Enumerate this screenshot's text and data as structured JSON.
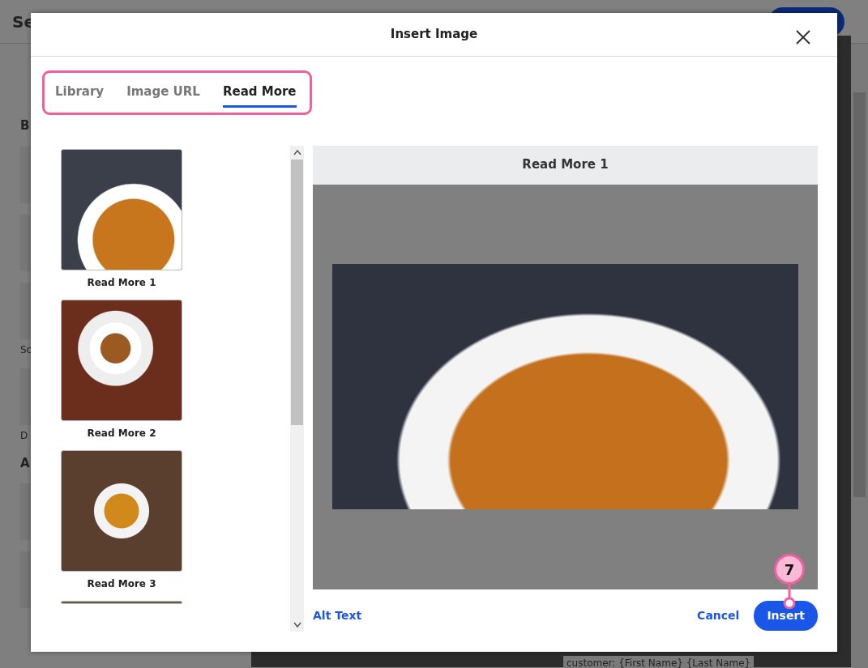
{
  "background": {
    "header_title": "Se",
    "sidebar": [
      {
        "kind": "heading",
        "text": "B"
      },
      {
        "kind": "tile"
      },
      {
        "kind": "tile"
      },
      {
        "kind": "tile",
        "caption": "Sc"
      },
      {
        "kind": "tile",
        "caption": "D"
      },
      {
        "kind": "heading",
        "text": "A"
      },
      {
        "kind": "tile"
      },
      {
        "kind": "tile"
      }
    ],
    "email_text": "customer: {First Name} {Last Name}"
  },
  "dialog": {
    "title": "Insert Image",
    "tabs": [
      {
        "label": "Library",
        "selected": false
      },
      {
        "label": "Image URL",
        "selected": false
      },
      {
        "label": "Read More",
        "selected": true
      }
    ],
    "images": [
      {
        "kind": "full",
        "label": "Read More 1"
      },
      {
        "kind": "full",
        "label": "Read More 2"
      },
      {
        "kind": "full",
        "label": "Read More 3"
      },
      {
        "kind": "partial"
      }
    ],
    "preview": {
      "title": "Read More 1"
    },
    "alt_text_link": "Alt Text",
    "cancel": "Cancel",
    "insert": "Insert"
  },
  "annotation": {
    "number": "7"
  }
}
